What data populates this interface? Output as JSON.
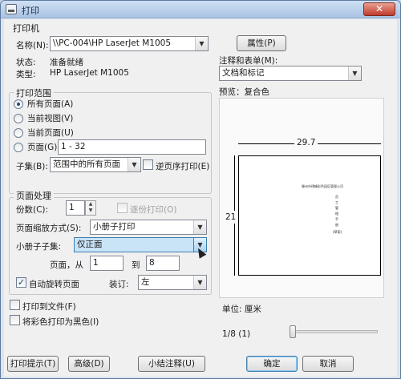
{
  "window": {
    "title": "打印",
    "close_glyph": "✕"
  },
  "printer": {
    "group_label": "打印机",
    "name_label": "名称(N):",
    "name_value": "\\\\PC-004\\HP LaserJet M1005",
    "properties_button": "属性(P)",
    "status_label": "状态:",
    "status_value": "准备就绪",
    "type_label": "类型:",
    "type_value": "HP LaserJet M1005",
    "comments_label": "注释和表单(M):",
    "comments_value": "文档和标记"
  },
  "range": {
    "group_label": "打印范围",
    "options": [
      "所有页面(A)",
      "当前视图(V)",
      "当前页面(U)",
      "页面(G)"
    ],
    "selected_index": 0,
    "pages_value": "1 - 32",
    "subset_label": "子集(B):",
    "subset_value": "范围中的所有页面",
    "reverse_label": "逆页序打印(E)"
  },
  "handling": {
    "group_label": "页面处理",
    "copies_label": "份数(C):",
    "copies_value": "1",
    "collate_label": "逐份打印(O)",
    "scaling_label": "页面缩放方式(S):",
    "scaling_value": "小册子打印",
    "booklet_subset_label": "小册子子集:",
    "booklet_subset_value": "仅正面",
    "page_from_label": "页面，从",
    "page_from_value": "1",
    "page_to_label": "到",
    "page_to_value": "8",
    "auto_rotate_label": "自动旋转页面",
    "auto_rotate_checked": true,
    "binding_label": "装订:",
    "binding_value": "左"
  },
  "options": {
    "print_to_file": "打印到文件(F)",
    "print_black": "将彩色打印为黑色(I)"
  },
  "preview": {
    "label": "预览：复合色",
    "width_dim": "29.7",
    "height_dim": "21",
    "page_lines": [
      "滕州市律峰彩色园区管理公司",
      "员",
      "工",
      "管",
      "理",
      "手",
      "册",
      "(草案)"
    ],
    "unit_label": "单位: 厘米",
    "page_indicator": "1/8 (1)",
    "slider_position": 0.0
  },
  "footer": {
    "tips_button": "打印提示(T)",
    "advanced_button": "高级(D)",
    "summarize_button": "小结注释(U)",
    "ok_button": "确定",
    "cancel_button": "取消"
  },
  "colors": {
    "accent": "#3c7fb1",
    "dialog_bg": "#f0f0f0",
    "title_bg": "#a9c3e3"
  }
}
